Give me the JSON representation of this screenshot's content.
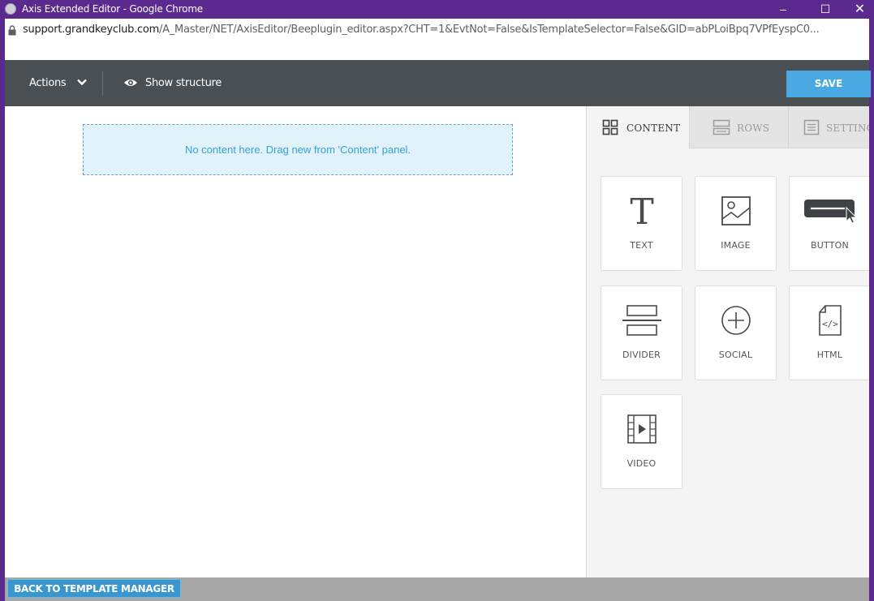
{
  "window": {
    "title": "Axis Extended Editor - Google Chrome",
    "minimize": "–",
    "maximize": "☐",
    "close": "✕"
  },
  "address": {
    "host": "support.grandkeyclub.com",
    "path": "/A_Master/NET/AxisEditor/Beeplugin_editor.aspx?CHT=1&EvtNot=False&IsTemplateSelector=False&GID=abPLoiBpq7VPfEyspC0..."
  },
  "toolbar": {
    "actions_label": "Actions",
    "show_structure_label": "Show structure",
    "save_label": "SAVE"
  },
  "stage": {
    "empty_message": "No content here. Drag new from 'Content' panel."
  },
  "sidebar": {
    "tabs": [
      {
        "label": "CONTENT",
        "icon": "grid-icon",
        "active": true
      },
      {
        "label": "ROWS",
        "icon": "rows-icon",
        "active": false
      },
      {
        "label": "SETTINGS",
        "icon": "settings-list-icon",
        "active": false
      }
    ],
    "blocks": [
      {
        "label": "TEXT",
        "icon": "text-t-icon"
      },
      {
        "label": "IMAGE",
        "icon": "image-icon"
      },
      {
        "label": "BUTTON",
        "icon": "button-cursor-icon"
      },
      {
        "label": "DIVIDER",
        "icon": "divider-icon"
      },
      {
        "label": "SOCIAL",
        "icon": "plus-circle-icon"
      },
      {
        "label": "HTML",
        "icon": "html-file-icon"
      },
      {
        "label": "VIDEO",
        "icon": "video-film-icon"
      }
    ]
  },
  "footer": {
    "back_label": "BACK TO TEMPLATE MANAGER"
  },
  "colors": {
    "window_frame": "#5b2a8e",
    "toolbar": "#4a4f53",
    "save_button": "#4aa9e3",
    "dropzone_bg": "#e1f2fb",
    "dropzone_text": "#35a0d8",
    "back_button": "#3a96cf"
  }
}
